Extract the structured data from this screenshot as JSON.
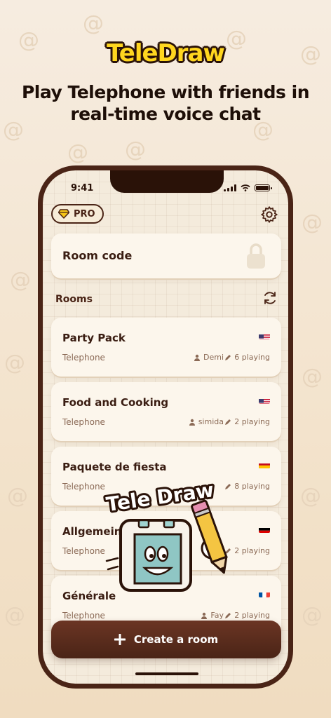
{
  "header": {
    "logo": "TeleDraw",
    "tagline_line1": "Play Telephone  with friends in",
    "tagline_line2": "real-time voice chat"
  },
  "status_bar": {
    "time": "9:41"
  },
  "pro_badge": {
    "label": "PRO"
  },
  "room_code": {
    "label": "Room code"
  },
  "rooms": {
    "label": "Rooms",
    "items": [
      {
        "name": "Party Pack",
        "mode": "Telephone",
        "host": "Demi",
        "players": "6 playing",
        "flag": "us"
      },
      {
        "name": "Food and Cooking",
        "mode": "Telephone",
        "host": "simida",
        "players": "2 playing",
        "flag": "us"
      },
      {
        "name": "Paquete de fiesta",
        "mode": "Telephone",
        "host": "",
        "players": "8 playing",
        "flag": "es"
      },
      {
        "name": "Allgemein",
        "mode": "Telephone",
        "host": "Sn",
        "players": "2 playing",
        "flag": "de"
      },
      {
        "name": "Générale",
        "mode": "Telephone",
        "host": "Fay",
        "players": "2 playing",
        "flag": "fr"
      }
    ]
  },
  "create_button": {
    "label": "Create a room"
  },
  "mascot": {
    "wordmark": "Tele Draw"
  },
  "colors": {
    "brand_brown": "#4a2416",
    "logo_yellow": "#ffd61f",
    "card": "#fcf6ec"
  }
}
